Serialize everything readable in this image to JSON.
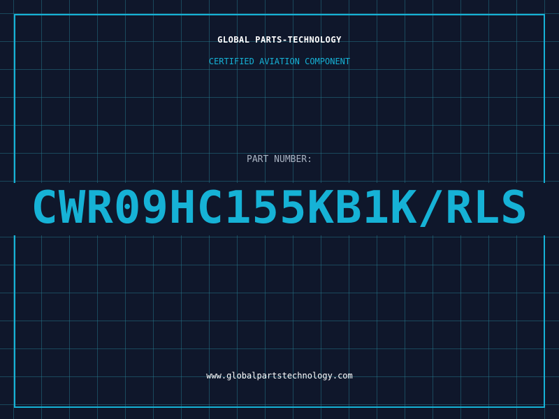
{
  "company": {
    "name": "GLOBAL PARTS-TECHNOLOGY",
    "tagline": "CERTIFIED AVIATION COMPONENT"
  },
  "part": {
    "label": "PART NUMBER:",
    "number": "CWR09HC155KB1K/RLS"
  },
  "footer": {
    "website": "www.globalpartstechnology.com"
  },
  "colors": {
    "background": "#0f172b",
    "accent": "#16b2d6",
    "grid": "#28828f"
  }
}
